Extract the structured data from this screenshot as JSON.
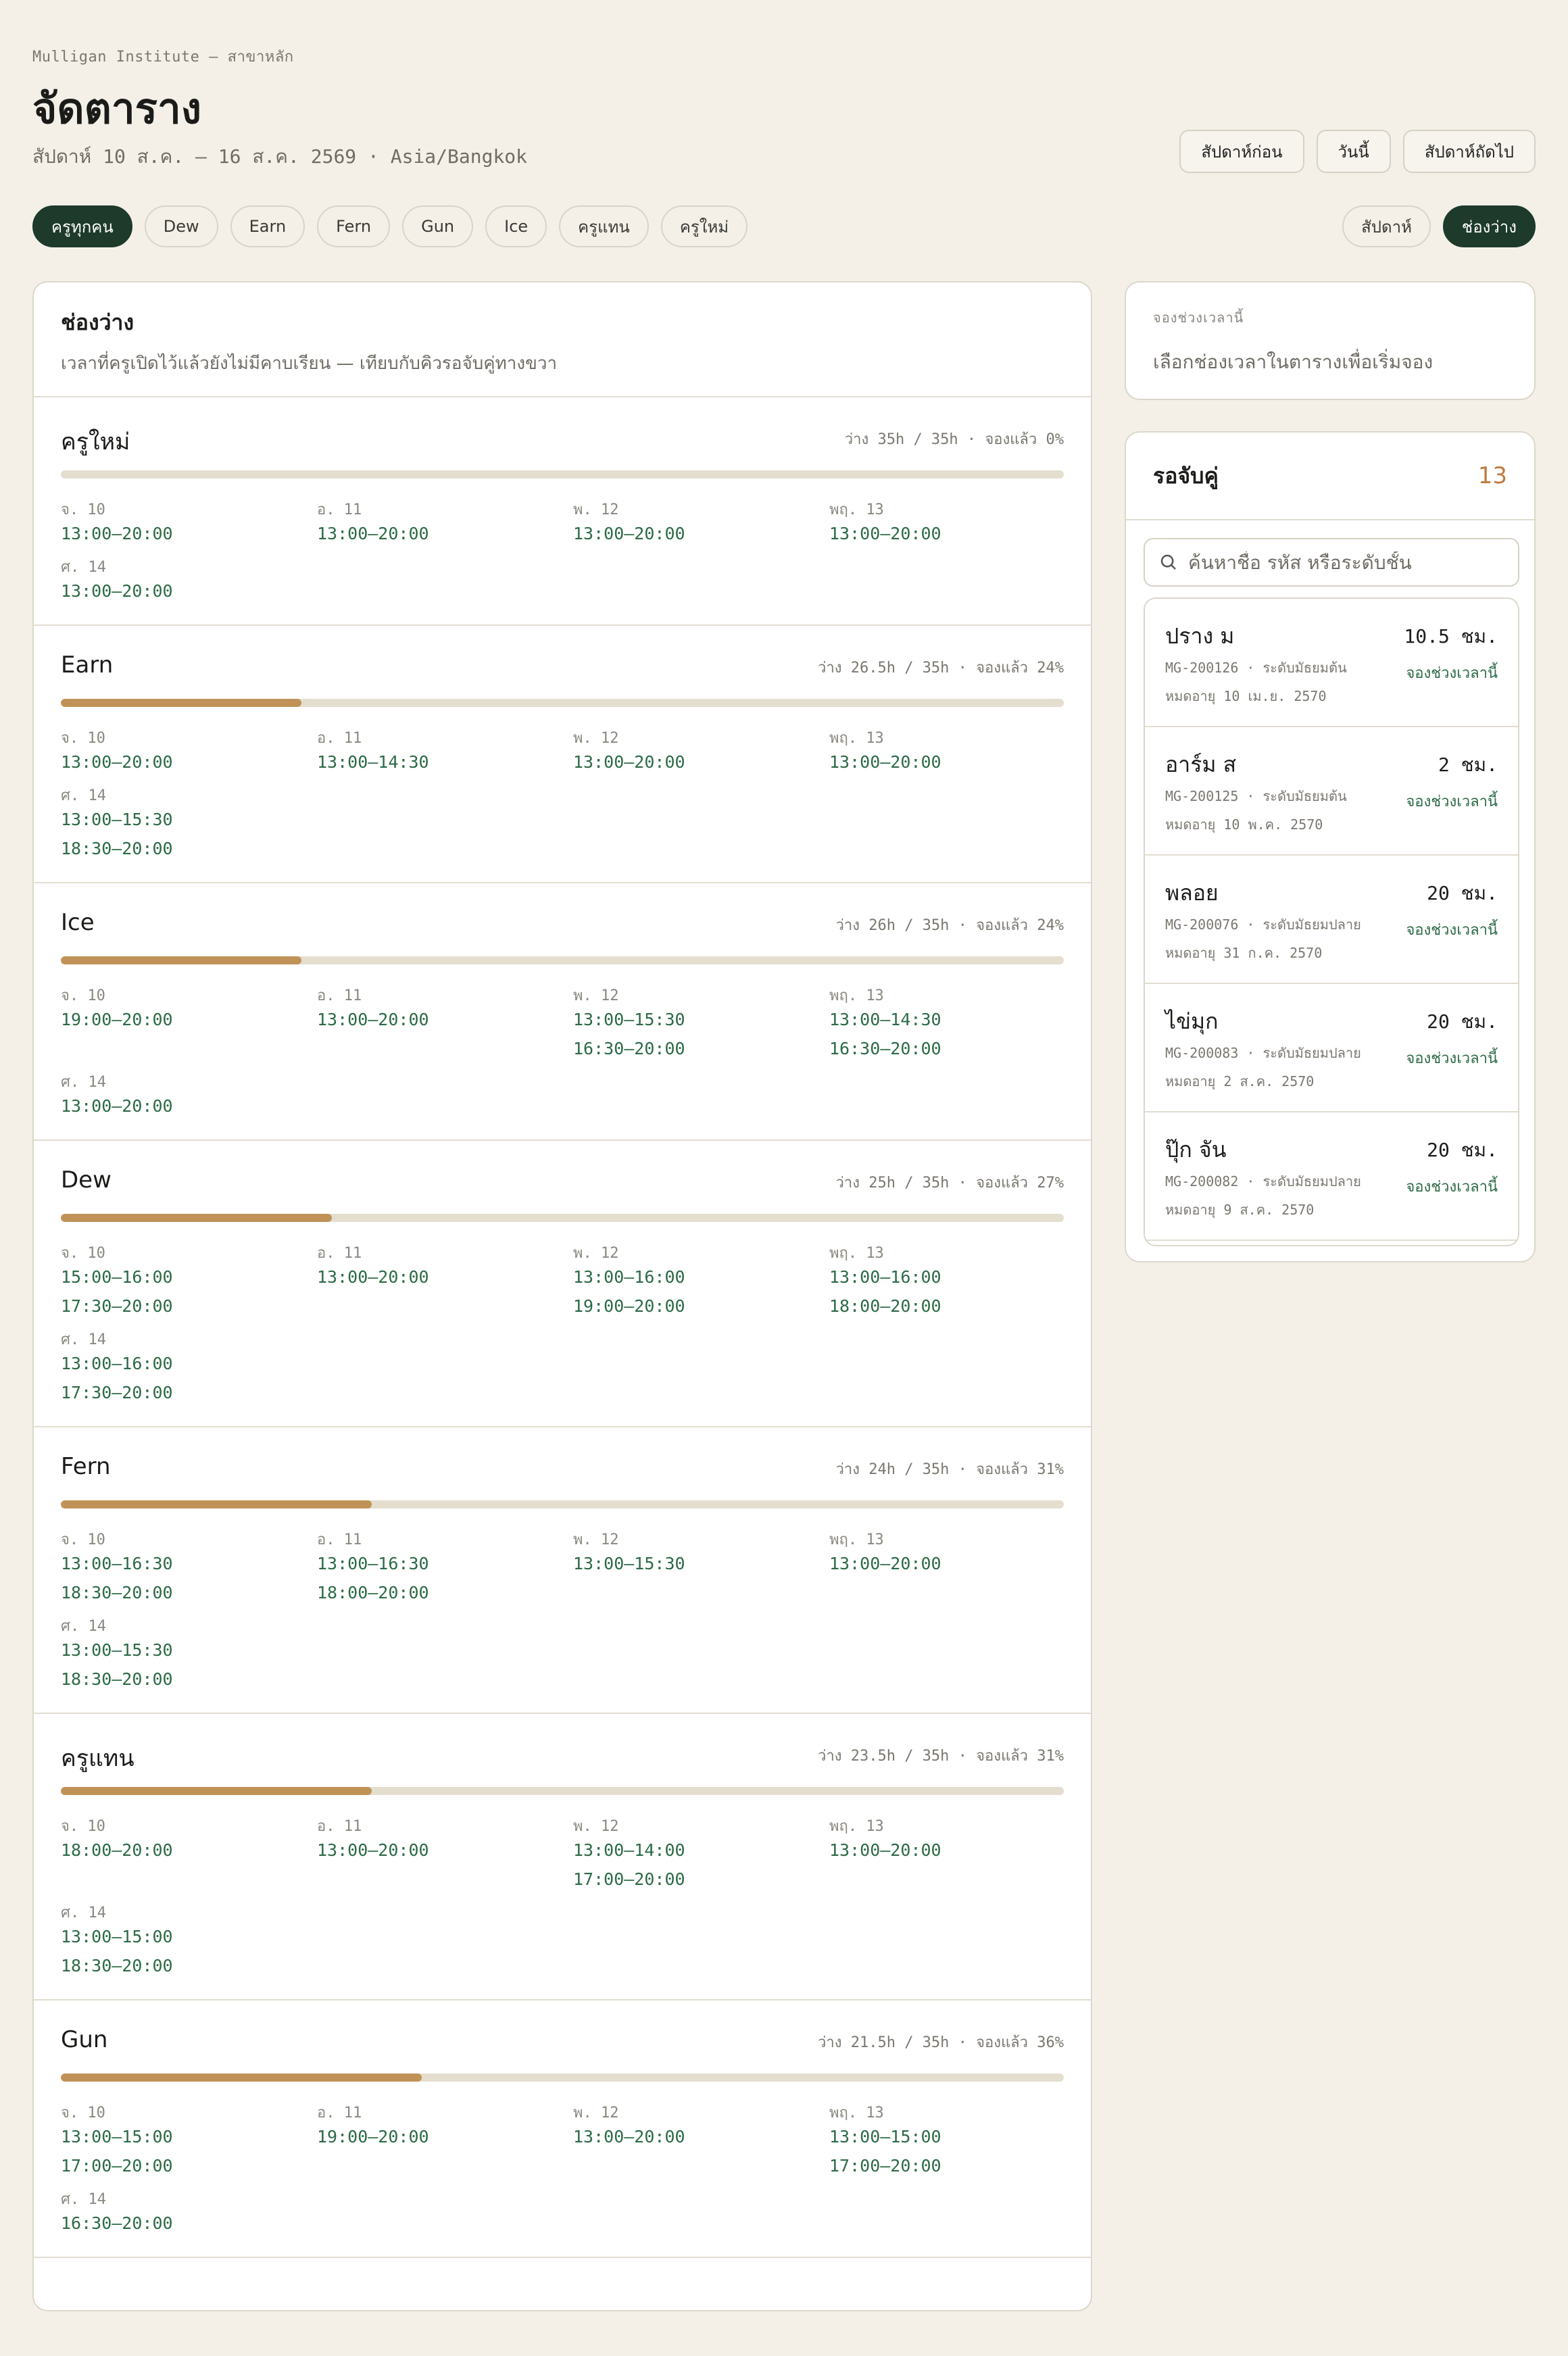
{
  "header": {
    "org": "Mulligan Institute — สาขาหลัก",
    "title": "จัดตาราง",
    "subtitle": "สัปดาห์ 10 ส.ค. – 16 ส.ค. 2569 · Asia/Bangkok",
    "nav": {
      "prev": "สัปดาห์ก่อน",
      "today": "วันนี้",
      "next": "สัปดาห์ถัดไป"
    }
  },
  "filters": [
    "ครูทุกคน",
    "Dew",
    "Earn",
    "Fern",
    "Gun",
    "Ice",
    "ครูแทน",
    "ครูใหม่"
  ],
  "active_filter": "ครูทุกคน",
  "views": {
    "week": "สัปดาห์",
    "free": "ช่องว่าง",
    "active": "ช่องว่าง"
  },
  "availability": {
    "title": "ช่องว่าง",
    "description": "เวลาที่ครูเปิดไว้แล้วยังไม่มีคาบเรียน — เทียบกับคิวรอจับคู่ทางขวา",
    "teachers": [
      {
        "name": "ครูใหม่",
        "stats": "ว่าง 35h / 35h · จองแล้ว 0%",
        "booked_pct": 0,
        "days": [
          {
            "label": "จ. 10",
            "slots": [
              "13:00–20:00"
            ]
          },
          {
            "label": "อ. 11",
            "slots": [
              "13:00–20:00"
            ]
          },
          {
            "label": "พ. 12",
            "slots": [
              "13:00–20:00"
            ]
          },
          {
            "label": "พฤ. 13",
            "slots": [
              "13:00–20:00"
            ]
          },
          {
            "label": "ศ. 14",
            "slots": [
              "13:00–20:00"
            ]
          }
        ]
      },
      {
        "name": "Earn",
        "stats": "ว่าง 26.5h / 35h · จองแล้ว 24%",
        "booked_pct": 24,
        "days": [
          {
            "label": "จ. 10",
            "slots": [
              "13:00–20:00"
            ]
          },
          {
            "label": "อ. 11",
            "slots": [
              "13:00–14:30"
            ]
          },
          {
            "label": "พ. 12",
            "slots": [
              "13:00–20:00"
            ]
          },
          {
            "label": "พฤ. 13",
            "slots": [
              "13:00–20:00"
            ]
          },
          {
            "label": "ศ. 14",
            "slots": [
              "13:00–15:30",
              "18:30–20:00"
            ]
          }
        ]
      },
      {
        "name": "Ice",
        "stats": "ว่าง 26h / 35h · จองแล้ว 24%",
        "booked_pct": 24,
        "days": [
          {
            "label": "จ. 10",
            "slots": [
              "19:00–20:00"
            ]
          },
          {
            "label": "อ. 11",
            "slots": [
              "13:00–20:00"
            ]
          },
          {
            "label": "พ. 12",
            "slots": [
              "13:00–15:30",
              "16:30–20:00"
            ]
          },
          {
            "label": "พฤ. 13",
            "slots": [
              "13:00–14:30",
              "16:30–20:00"
            ]
          },
          {
            "label": "ศ. 14",
            "slots": [
              "13:00–20:00"
            ]
          }
        ]
      },
      {
        "name": "Dew",
        "stats": "ว่าง 25h / 35h · จองแล้ว 27%",
        "booked_pct": 27,
        "days": [
          {
            "label": "จ. 10",
            "slots": [
              "15:00–16:00",
              "17:30–20:00"
            ]
          },
          {
            "label": "อ. 11",
            "slots": [
              "13:00–20:00"
            ]
          },
          {
            "label": "พ. 12",
            "slots": [
              "13:00–16:00",
              "19:00–20:00"
            ]
          },
          {
            "label": "พฤ. 13",
            "slots": [
              "13:00–16:00",
              "18:00–20:00"
            ]
          },
          {
            "label": "ศ. 14",
            "slots": [
              "13:00–16:00",
              "17:30–20:00"
            ]
          }
        ]
      },
      {
        "name": "Fern",
        "stats": "ว่าง 24h / 35h · จองแล้ว 31%",
        "booked_pct": 31,
        "days": [
          {
            "label": "จ. 10",
            "slots": [
              "13:00–16:30",
              "18:30–20:00"
            ]
          },
          {
            "label": "อ. 11",
            "slots": [
              "13:00–16:30",
              "18:00–20:00"
            ]
          },
          {
            "label": "พ. 12",
            "slots": [
              "13:00–15:30"
            ]
          },
          {
            "label": "พฤ. 13",
            "slots": [
              "13:00–20:00"
            ]
          },
          {
            "label": "ศ. 14",
            "slots": [
              "13:00–15:30",
              "18:30–20:00"
            ]
          }
        ]
      },
      {
        "name": "ครูแทน",
        "stats": "ว่าง 23.5h / 35h · จองแล้ว 31%",
        "booked_pct": 31,
        "days": [
          {
            "label": "จ. 10",
            "slots": [
              "18:00–20:00"
            ]
          },
          {
            "label": "อ. 11",
            "slots": [
              "13:00–20:00"
            ]
          },
          {
            "label": "พ. 12",
            "slots": [
              "13:00–14:00",
              "17:00–20:00"
            ]
          },
          {
            "label": "พฤ. 13",
            "slots": [
              "13:00–20:00"
            ]
          },
          {
            "label": "ศ. 14",
            "slots": [
              "13:00–15:00",
              "18:30–20:00"
            ]
          }
        ]
      },
      {
        "name": "Gun",
        "stats": "ว่าง 21.5h / 35h · จองแล้ว 36%",
        "booked_pct": 36,
        "days": [
          {
            "label": "จ. 10",
            "slots": [
              "13:00–15:00",
              "17:00–20:00"
            ]
          },
          {
            "label": "อ. 11",
            "slots": [
              "19:00–20:00"
            ]
          },
          {
            "label": "พ. 12",
            "slots": [
              "13:00–20:00"
            ]
          },
          {
            "label": "พฤ. 13",
            "slots": [
              "13:00–15:00",
              "17:00–20:00"
            ]
          },
          {
            "label": "ศ. 14",
            "slots": [
              "16:30–20:00"
            ]
          }
        ]
      }
    ]
  },
  "selection": {
    "label": "จองช่วงเวลานี้",
    "message": "เลือกช่องเวลาในตารางเพื่อเริ่มจอง"
  },
  "queue": {
    "title": "รอจับคู่",
    "count": "13",
    "search_placeholder": "ค้นหาชื่อ รหัส หรือระดับชั้น",
    "students": [
      {
        "name": "ปราง ม",
        "hours": "10.5 ชม.",
        "meta": "MG-200126 · ระดับมัธยมต้น",
        "expiry": "หมดอายุ 10 เม.ย. 2570",
        "action": "จองช่วงเวลานี้"
      },
      {
        "name": "อาร์ม ส",
        "hours": "2 ชม.",
        "meta": "MG-200125 · ระดับมัธยมต้น",
        "expiry": "หมดอายุ 10 พ.ค. 2570",
        "action": "จองช่วงเวลานี้"
      },
      {
        "name": "พลอย",
        "hours": "20 ชม.",
        "meta": "MG-200076 · ระดับมัธยมปลาย",
        "expiry": "หมดอายุ 31 ก.ค. 2570",
        "action": "จองช่วงเวลานี้"
      },
      {
        "name": "ไข่มุก",
        "hours": "20 ชม.",
        "meta": "MG-200083 · ระดับมัธยมปลาย",
        "expiry": "หมดอายุ 2 ส.ค. 2570",
        "action": "จองช่วงเวลานี้"
      },
      {
        "name": "ปุ๊ก จัน",
        "hours": "20 ชม.",
        "meta": "MG-200082 · ระดับมัธยมปลาย",
        "expiry": "หมดอายุ 9 ส.ค. 2570",
        "action": "จองช่วงเวลานี้"
      }
    ]
  },
  "colors": {
    "accent_dark": "#1d3a2a",
    "slot_green": "#2c6a46",
    "bar_fill": "#c09257",
    "count_orange": "#c07a40"
  }
}
